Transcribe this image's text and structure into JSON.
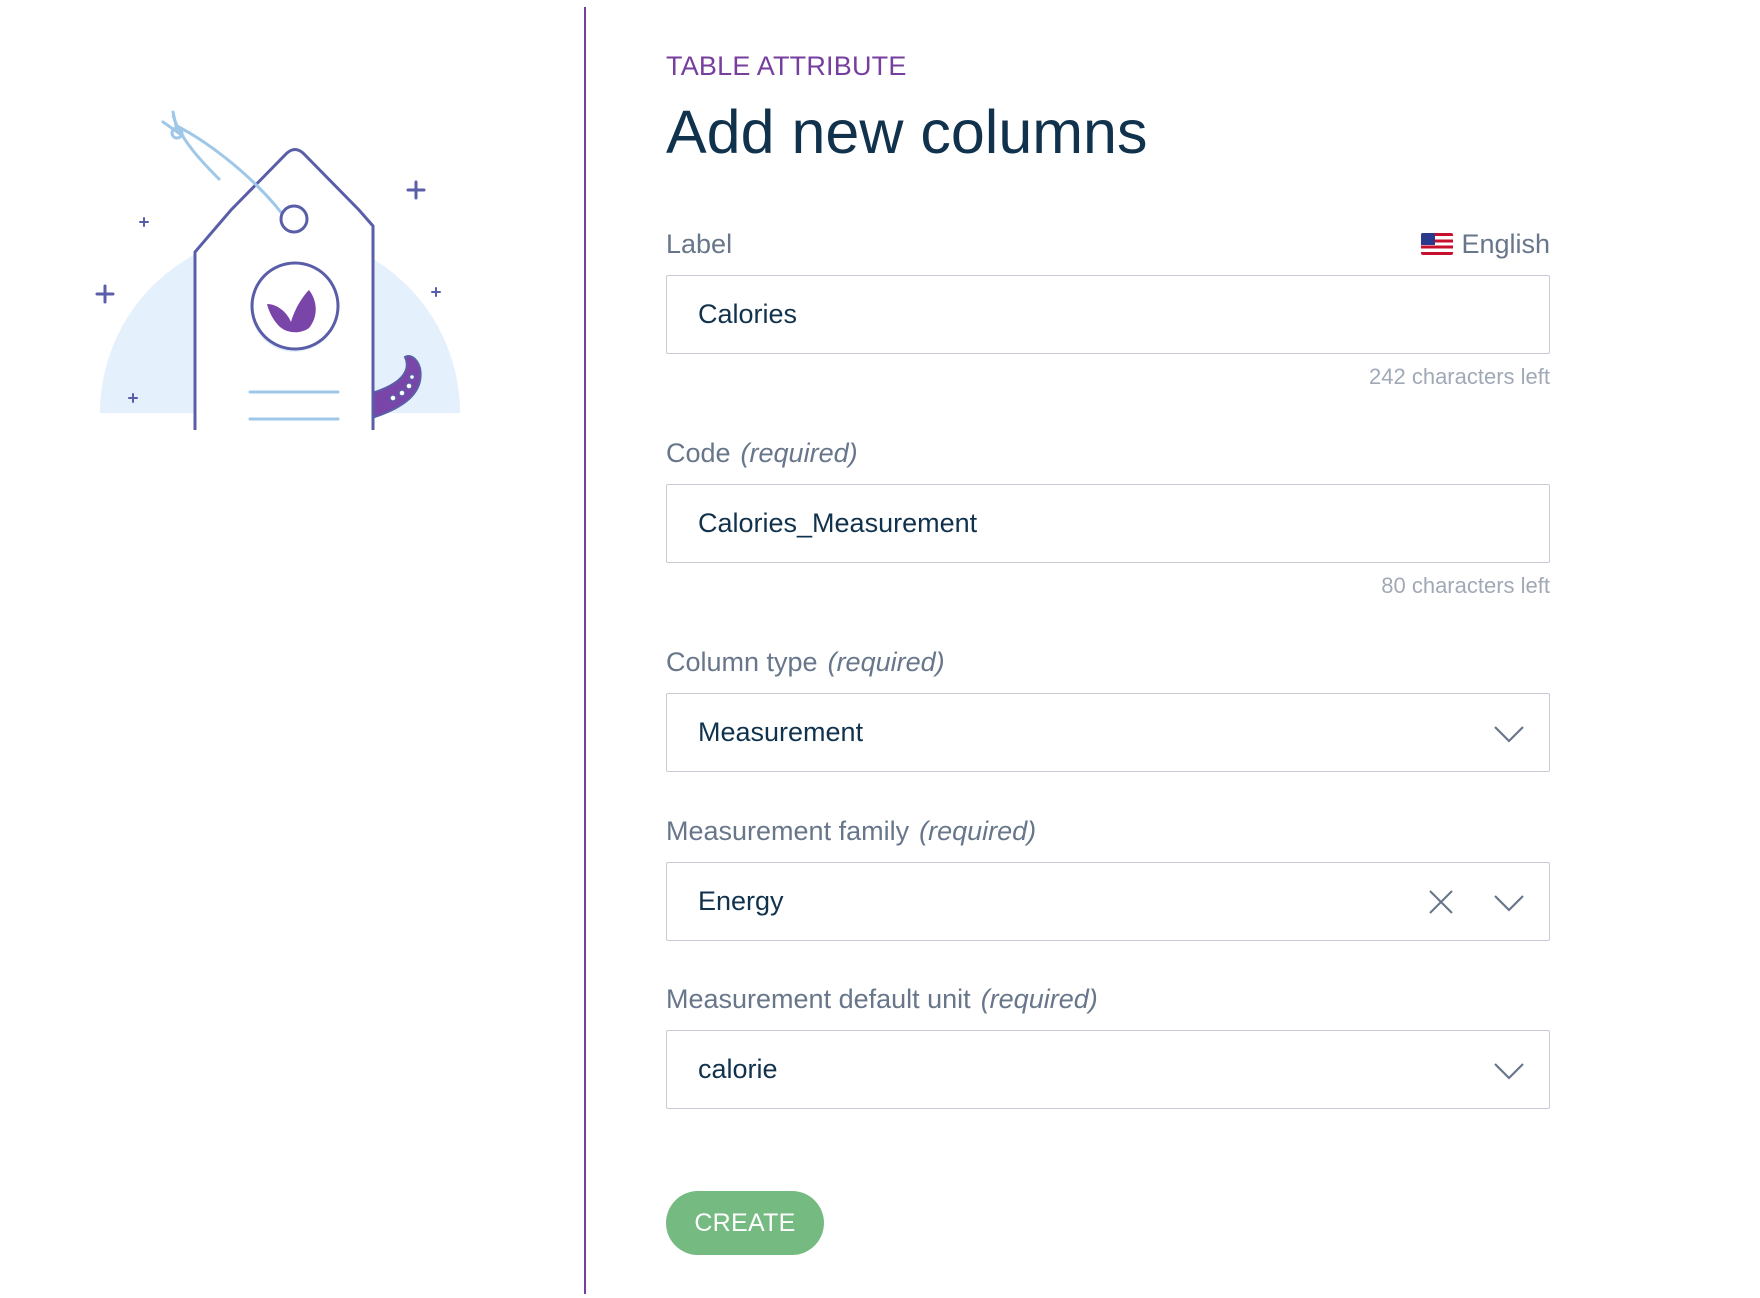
{
  "header": {
    "subtitle": "TABLE ATTRIBUTE",
    "title": "Add new columns"
  },
  "illustration": {
    "icon": "price-tag-illustration",
    "accent_color": "#5a5ea8",
    "light_color": "#e4f0fb"
  },
  "fields": {
    "label": {
      "label": "Label",
      "locale_flag": "us-flag-icon",
      "locale": "English",
      "value": "Calories",
      "helper": "242 characters left"
    },
    "code": {
      "label": "Code",
      "required": "(required)",
      "value": "Calories_Measurement",
      "helper": "80 characters left"
    },
    "column_type": {
      "label": "Column type",
      "required": "(required)",
      "value": "Measurement"
    },
    "measurement_family": {
      "label": "Measurement family",
      "required": "(required)",
      "value": "Energy"
    },
    "default_unit": {
      "label": "Measurement default unit",
      "required": "(required)",
      "value": "calorie"
    }
  },
  "actions": {
    "create_label": "CREATE"
  },
  "colors": {
    "brand_purple": "#763e9e",
    "text_dark": "#11324d",
    "text_muted": "#67768a",
    "button_green": "#67b373",
    "border": "#c7cbd4"
  }
}
